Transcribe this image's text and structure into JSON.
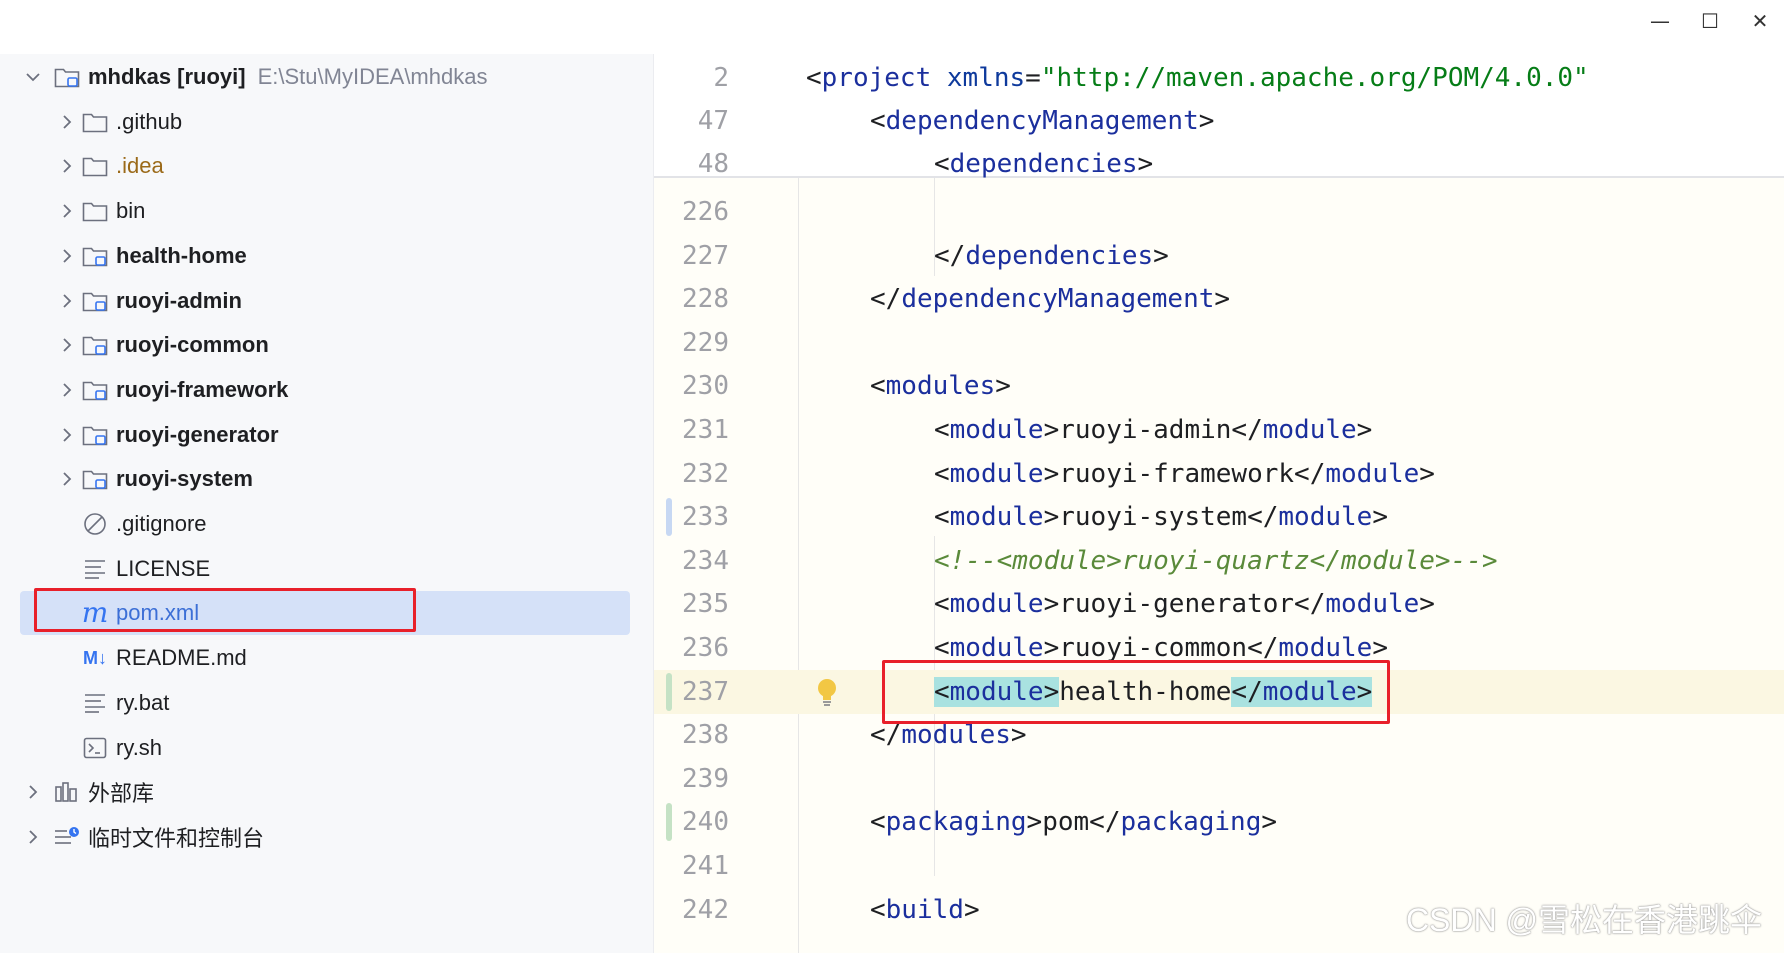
{
  "window": {
    "controls": {
      "minimize": "—",
      "maximize": "☐",
      "close": "✕"
    }
  },
  "project_tree": {
    "root": {
      "name": "mhdkas",
      "module": "[ruoyi]",
      "path": "E:\\Stu\\MyIDEA\\mhdkas"
    },
    "items": [
      {
        "label": ".github",
        "icon": "folder-icon"
      },
      {
        "label": ".idea",
        "icon": "folder-icon"
      },
      {
        "label": "bin",
        "icon": "folder-icon"
      },
      {
        "label": "health-home",
        "icon": "module-folder-icon"
      },
      {
        "label": "ruoyi-admin",
        "icon": "module-folder-icon"
      },
      {
        "label": "ruoyi-common",
        "icon": "module-folder-icon"
      },
      {
        "label": "ruoyi-framework",
        "icon": "module-folder-icon"
      },
      {
        "label": "ruoyi-generator",
        "icon": "module-folder-icon"
      },
      {
        "label": "ruoyi-system",
        "icon": "module-folder-icon"
      },
      {
        "label": ".gitignore",
        "icon": "ignore-file-icon"
      },
      {
        "label": "LICENSE",
        "icon": "text-file-icon"
      },
      {
        "label": "pom.xml",
        "icon": "maven-icon",
        "selected": true
      },
      {
        "label": "README.md",
        "icon": "markdown-icon",
        "icon_text": "M↓"
      },
      {
        "label": "ry.bat",
        "icon": "text-file-icon"
      },
      {
        "label": "ry.sh",
        "icon": "shell-file-icon"
      }
    ],
    "external_libraries": "外部库",
    "scratches": "临时文件和控制台"
  },
  "editor": {
    "sticky_lines": [
      {
        "num": "2",
        "parts": [
          [
            "br",
            "<"
          ],
          [
            "tg",
            "project "
          ],
          [
            "at",
            "xmlns"
          ],
          [
            "br",
            "="
          ],
          [
            "str",
            "\"http://maven.apache.org/POM/4.0.0\""
          ]
        ]
      },
      {
        "num": "47",
        "parts": [
          [
            "br",
            "<"
          ],
          [
            "tg",
            "dependencyManagement"
          ],
          [
            "br",
            ">"
          ]
        ]
      },
      {
        "num": "48",
        "parts": [
          [
            "br",
            "<"
          ],
          [
            "tg",
            "dependencies"
          ],
          [
            "br",
            ">"
          ]
        ]
      }
    ],
    "lines": [
      {
        "num": "226",
        "parts": []
      },
      {
        "num": "227",
        "parts": [
          [
            "br",
            "</"
          ],
          [
            "tg",
            "dependencies"
          ],
          [
            "br",
            ">"
          ]
        ]
      },
      {
        "num": "228",
        "parts": [
          [
            "br",
            "</"
          ],
          [
            "tg",
            "dependencyManagement"
          ],
          [
            "br",
            ">"
          ]
        ]
      },
      {
        "num": "229",
        "parts": []
      },
      {
        "num": "230",
        "parts": [
          [
            "br",
            "<"
          ],
          [
            "tg",
            "modules"
          ],
          [
            "br",
            ">"
          ]
        ]
      },
      {
        "num": "231",
        "parts": [
          [
            "br",
            "<"
          ],
          [
            "tg",
            "module"
          ],
          [
            "br",
            ">"
          ],
          [
            "br",
            "ruoyi-admin"
          ],
          [
            "br",
            "</"
          ],
          [
            "tg",
            "module"
          ],
          [
            "br",
            ">"
          ]
        ]
      },
      {
        "num": "232",
        "parts": [
          [
            "br",
            "<"
          ],
          [
            "tg",
            "module"
          ],
          [
            "br",
            ">"
          ],
          [
            "br",
            "ruoyi-framework"
          ],
          [
            "br",
            "</"
          ],
          [
            "tg",
            "module"
          ],
          [
            "br",
            ">"
          ]
        ]
      },
      {
        "num": "233",
        "parts": [
          [
            "br",
            "<"
          ],
          [
            "tg",
            "module"
          ],
          [
            "br",
            ">"
          ],
          [
            "br",
            "ruoyi-system"
          ],
          [
            "br",
            "</"
          ],
          [
            "tg",
            "module"
          ],
          [
            "br",
            ">"
          ]
        ]
      },
      {
        "num": "234",
        "parts": [
          [
            "cmt",
            "<!--<module>ruoyi-quartz</module>-->"
          ]
        ]
      },
      {
        "num": "235",
        "parts": [
          [
            "br",
            "<"
          ],
          [
            "tg",
            "module"
          ],
          [
            "br",
            ">"
          ],
          [
            "br",
            "ruoyi-generator"
          ],
          [
            "br",
            "</"
          ],
          [
            "tg",
            "module"
          ],
          [
            "br",
            ">"
          ]
        ]
      },
      {
        "num": "236",
        "parts": [
          [
            "br",
            "<"
          ],
          [
            "tg",
            "module"
          ],
          [
            "br",
            ">"
          ],
          [
            "br",
            "ruoyi-common"
          ],
          [
            "br",
            "</"
          ],
          [
            "tg",
            "module"
          ],
          [
            "br",
            ">"
          ]
        ]
      },
      {
        "num": "237",
        "parts": [
          [
            "mk",
            "<"
          ],
          [
            "mkt",
            "module"
          ],
          [
            "mk",
            ">"
          ],
          [
            "br",
            "health-home"
          ],
          [
            "mk",
            "</"
          ],
          [
            "mkt",
            "module"
          ],
          [
            "mk",
            ">"
          ]
        ]
      },
      {
        "num": "238",
        "parts": [
          [
            "br",
            "</"
          ],
          [
            "tg",
            "modules"
          ],
          [
            "br",
            ">"
          ]
        ]
      },
      {
        "num": "239",
        "parts": []
      },
      {
        "num": "240",
        "parts": [
          [
            "br",
            "<"
          ],
          [
            "tg",
            "packaging"
          ],
          [
            "br",
            ">"
          ],
          [
            "br",
            "pom"
          ],
          [
            "br",
            "</"
          ],
          [
            "tg",
            "packaging"
          ],
          [
            "br",
            ">"
          ]
        ]
      },
      {
        "num": "241",
        "parts": []
      },
      {
        "num": "242",
        "parts": [
          [
            "br",
            "<"
          ],
          [
            "tg",
            "build"
          ],
          [
            "br",
            ">"
          ]
        ]
      }
    ],
    "hint_icon": "lightbulb-icon"
  },
  "watermark": "CSDN @雪松在香港跳伞"
}
